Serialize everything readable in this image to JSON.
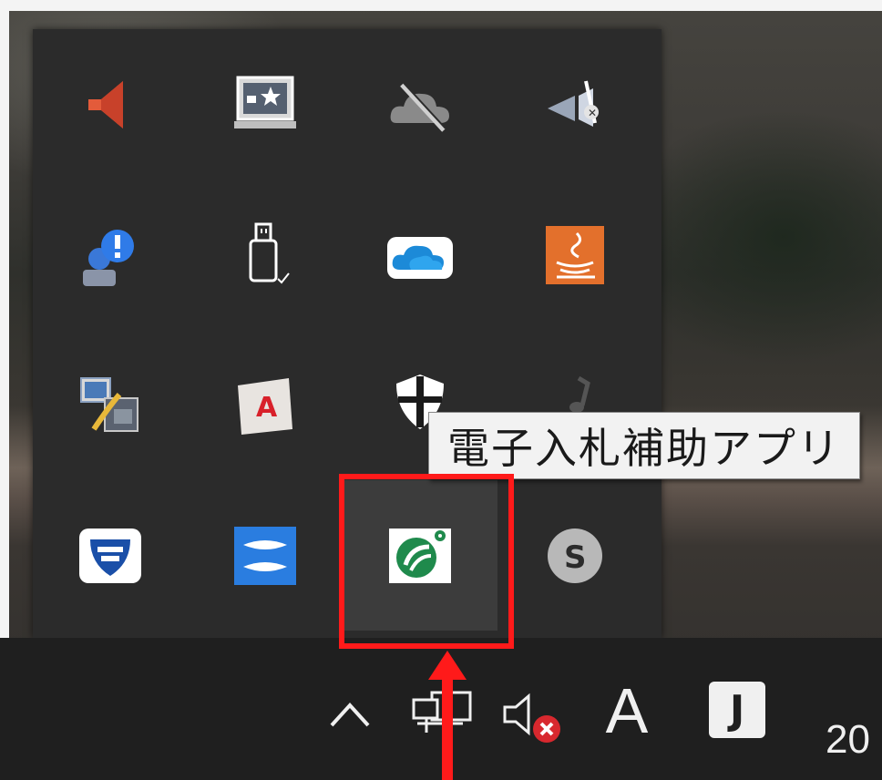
{
  "tooltip": {
    "text": "電子入札補助アプリ"
  },
  "tray": {
    "rows": [
      [
        "speaker-red-icon",
        "screen-star-icon",
        "cloud-offline-icon",
        "network-slash-icon"
      ],
      [
        "user-warning-icon",
        "usb-drive-icon",
        "onedrive-icon",
        "java-icon"
      ],
      [
        "display-settings-icon",
        "acrobat-icon",
        "shield-icon",
        "music-note-icon"
      ],
      [
        "security-fshield-icon",
        "app-s-blue-icon",
        "electronic-bid-icon",
        "skype-icon"
      ]
    ],
    "hovered": "electronic-bid-icon"
  },
  "taskbar": {
    "chevron_label": "^",
    "ime_label": "A",
    "ime_j_label": "J",
    "clock_partial": "20"
  },
  "colors": {
    "highlight": "#ff1a1a",
    "bid_app_green": "#1f8a4c",
    "flyout_bg": "#2b2b2b"
  }
}
